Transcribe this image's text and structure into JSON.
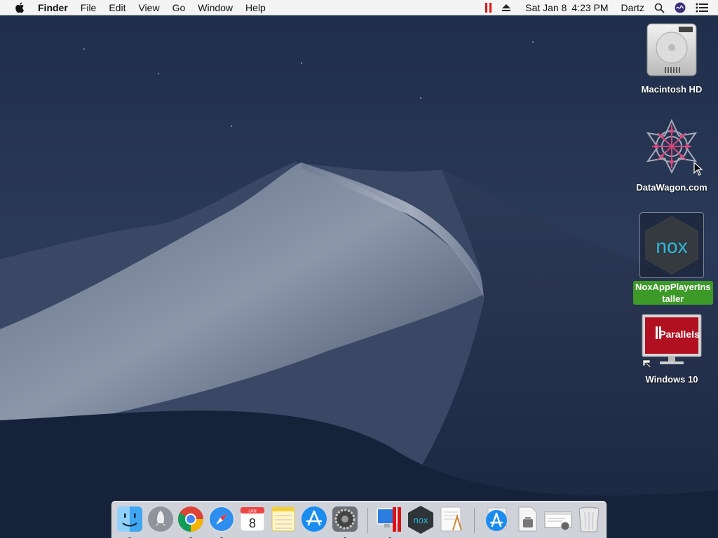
{
  "menubar": {
    "app_name": "Finder",
    "items": [
      "File",
      "Edit",
      "View",
      "Go",
      "Window",
      "Help"
    ],
    "status": {
      "date": "Sat Jan 8",
      "time": "4:23 PM",
      "user": "Dartz"
    }
  },
  "desktop_icons": [
    {
      "label": "Macintosh HD",
      "icon": "hard-drive-icon"
    },
    {
      "label": "DataWagon.com",
      "icon": "datawagon-star-icon"
    },
    {
      "label": "NoxAppPlayerIns",
      "label2": "taller",
      "icon": "nox-app-icon",
      "selected": true
    },
    {
      "label": "Windows 10",
      "icon": "parallels-vm-icon",
      "badge": "Parallels"
    }
  ],
  "dock": {
    "calendar_month": "JAN",
    "calendar_day": "8",
    "nox_text": "nox",
    "apps": [
      "finder-icon",
      "launchpad-icon",
      "chrome-icon",
      "safari-icon",
      "calendar-icon",
      "notes-icon",
      "app-store-icon",
      "system-preferences-icon",
      "parallels-desktop-icon",
      "nox-icon",
      "textedit-icon",
      "downloads-stack-icon",
      "documents-stack-icon",
      "screenshot-stack-icon",
      "trash-icon"
    ]
  },
  "colors": {
    "selection_green": "#3d9a29",
    "parallels_red": "#dd1111",
    "nox_teal": "#2fb8d9"
  }
}
